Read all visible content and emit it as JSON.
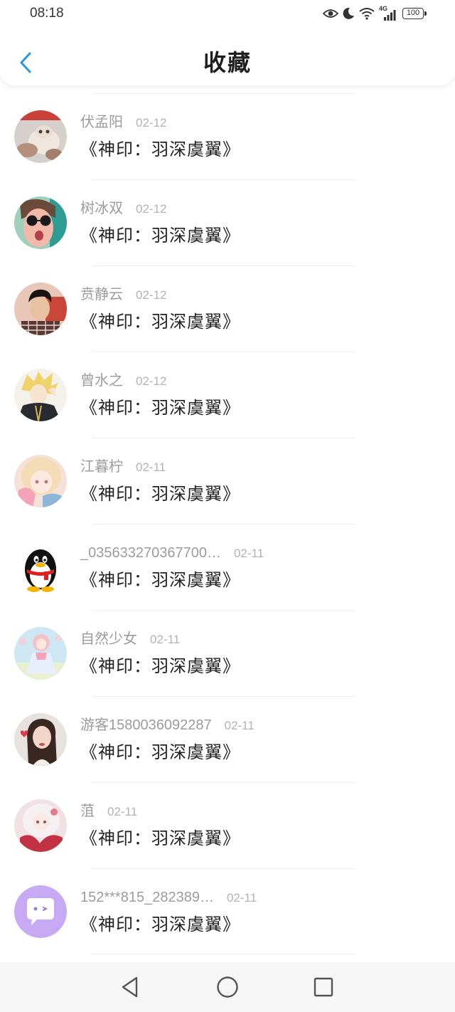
{
  "status_bar": {
    "time": "08:18",
    "network": "4G",
    "battery": "100",
    "icons": [
      "eye-icon",
      "moon-icon",
      "wifi-icon",
      "signal-icon",
      "battery-icon"
    ]
  },
  "header": {
    "title": "收藏",
    "back_icon": "chevron-left-icon"
  },
  "colors": {
    "accent": "#2b95e9"
  },
  "favorites": [
    {
      "name": "伏孟阳",
      "date": "02-12",
      "title": "《神印：羽深虞翼》"
    },
    {
      "name": "树冰双",
      "date": "02-12",
      "title": "《神印：羽深虞翼》"
    },
    {
      "name": "贲静云",
      "date": "02-12",
      "title": "《神印：羽深虞翼》"
    },
    {
      "name": "曾水之",
      "date": "02-12",
      "title": "《神印：羽深虞翼》"
    },
    {
      "name": "江暮柠",
      "date": "02-11",
      "title": "《神印：羽深虞翼》"
    },
    {
      "name": "_035633270367700…",
      "date": "02-11",
      "title": "《神印：羽深虞翼》"
    },
    {
      "name": "自然少女",
      "date": "02-11",
      "title": "《神印：羽深虞翼》"
    },
    {
      "name": "游客1580036092287",
      "date": "02-11",
      "title": "《神印：羽深虞翼》"
    },
    {
      "name": "菹",
      "date": "02-11",
      "title": "《神印：羽深虞翼》"
    },
    {
      "name": "152***815_282389…",
      "date": "02-11",
      "title": "《神印：羽深虞翼》"
    }
  ],
  "nav_bar": {
    "icons": [
      "back-triangle-icon",
      "home-circle-icon",
      "recents-square-icon"
    ]
  }
}
